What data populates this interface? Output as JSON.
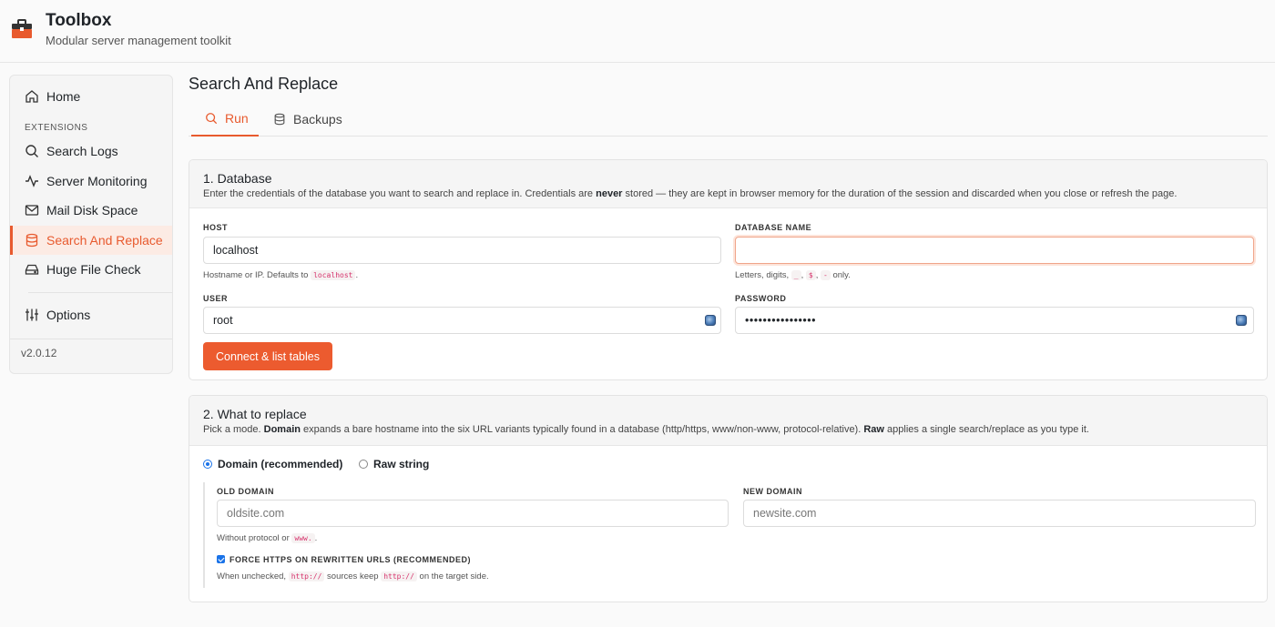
{
  "app": {
    "title": "Toolbox",
    "subtitle": "Modular server management toolkit",
    "version": "v2.0.12",
    "accent": "#e85a2e"
  },
  "sidebar": {
    "home": {
      "label": "Home",
      "icon": "home-icon"
    },
    "section_label": "EXTENSIONS",
    "items": [
      {
        "label": "Search Logs",
        "icon": "search-icon"
      },
      {
        "label": "Server Monitoring",
        "icon": "activity-icon"
      },
      {
        "label": "Mail Disk Space",
        "icon": "mail-icon"
      },
      {
        "label": "Search And Replace",
        "icon": "database-icon",
        "active": true
      },
      {
        "label": "Huge File Check",
        "icon": "drive-icon"
      }
    ],
    "options": {
      "label": "Options",
      "icon": "sliders-icon"
    }
  },
  "page": {
    "title": "Search And Replace",
    "tabs": [
      {
        "label": "Run",
        "icon": "search-icon",
        "active": true
      },
      {
        "label": "Backups",
        "icon": "database-icon"
      }
    ]
  },
  "database": {
    "title": "1. Database",
    "desc_pre": "Enter the credentials of the database you want to search and replace in. Credentials are ",
    "desc_bold": "never",
    "desc_post": " stored — they are kept in browser memory for the duration of the session and discarded when you close or refresh the page.",
    "host": {
      "label": "HOST",
      "value": "localhost",
      "help_pre": "Hostname or IP. Defaults to ",
      "help_code": "localhost",
      "help_post": "."
    },
    "dbname": {
      "label": "DATABASE NAME",
      "value": "",
      "help_pre": "Letters, digits, ",
      "help_codes": [
        "_",
        "$",
        "-"
      ],
      "help_post": " only."
    },
    "user": {
      "label": "USER",
      "value": "root"
    },
    "password": {
      "label": "PASSWORD",
      "value": "••••••••••••••••"
    },
    "connect_label": "Connect & list tables"
  },
  "replace": {
    "title": "2. What to replace",
    "desc_pre": "Pick a mode. ",
    "desc_b1": "Domain",
    "desc_mid": " expands a bare hostname into the six URL variants typically found in a database (http/https, www/non-www, protocol-relative). ",
    "desc_b2": "Raw",
    "desc_post": " applies a single search/replace as you type it.",
    "mode_domain": "Domain (recommended)",
    "mode_raw": "Raw string",
    "old_domain": {
      "label": "OLD DOMAIN",
      "placeholder": "oldsite.com",
      "help_pre": "Without protocol or ",
      "help_code": "www.",
      "help_post": "."
    },
    "new_domain": {
      "label": "NEW DOMAIN",
      "placeholder": "newsite.com"
    },
    "force_https": {
      "label": "FORCE HTTPS ON REWRITTEN URLS (RECOMMENDED)",
      "checked": true,
      "help_pre": "When unchecked, ",
      "help_code1": "http://",
      "help_mid": " sources keep ",
      "help_code2": "http://",
      "help_post": " on the target side."
    }
  }
}
